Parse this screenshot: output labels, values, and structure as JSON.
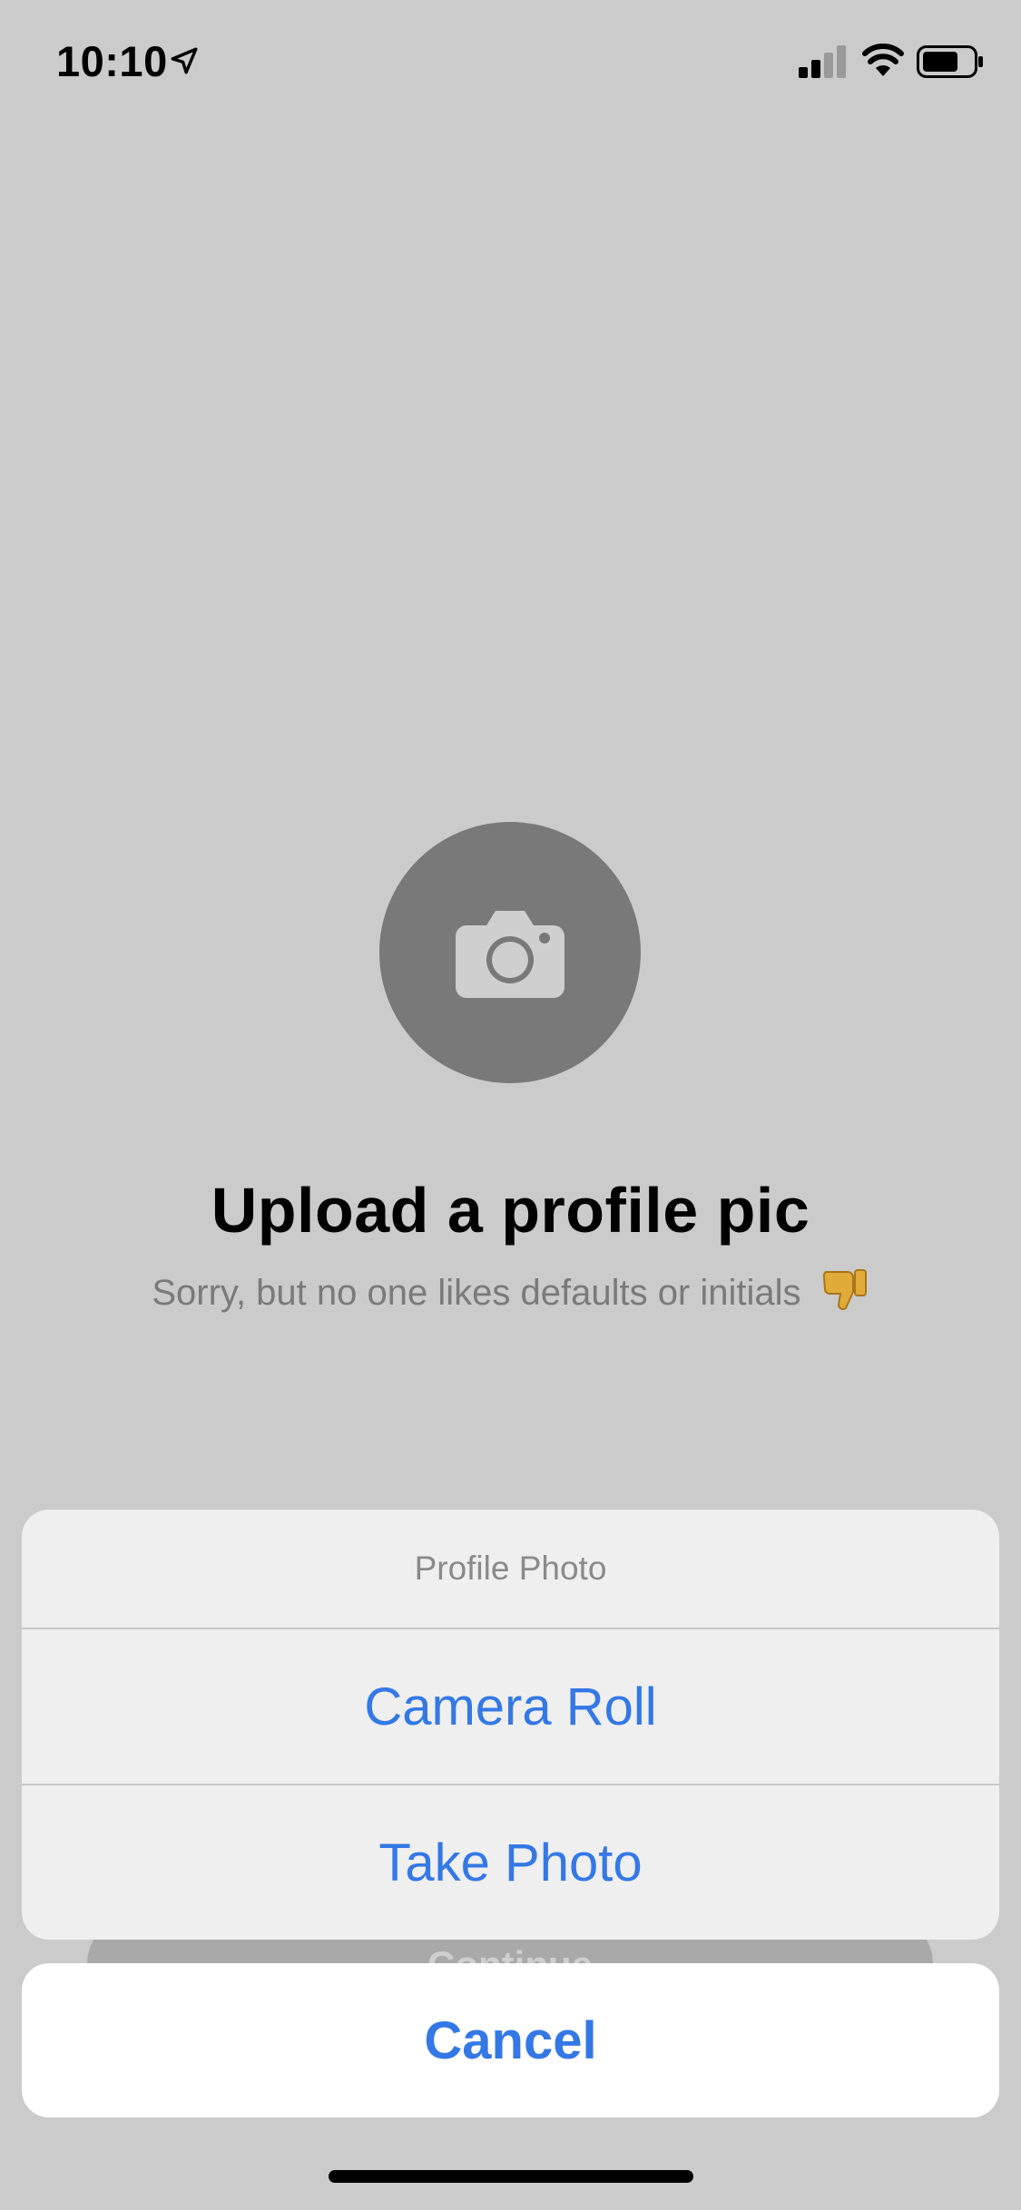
{
  "status_bar": {
    "time": "10:10",
    "icons": [
      "location-arrow-icon",
      "cellular-signal-icon",
      "wifi-icon",
      "battery-icon"
    ]
  },
  "main": {
    "avatar_icon": "camera-icon",
    "title": "Upload a profile pic",
    "subtitle": "Sorry, but no one likes defaults or initials",
    "subtitle_emoji": "thumbs-down-emoji",
    "continue_label": "Continue"
  },
  "action_sheet": {
    "title": "Profile Photo",
    "options": [
      {
        "label": "Camera Roll"
      },
      {
        "label": "Take Photo"
      }
    ],
    "cancel_label": "Cancel"
  },
  "colors": {
    "background": "#cbcbcb",
    "accent": "#3478e6",
    "avatar": "#797979"
  }
}
